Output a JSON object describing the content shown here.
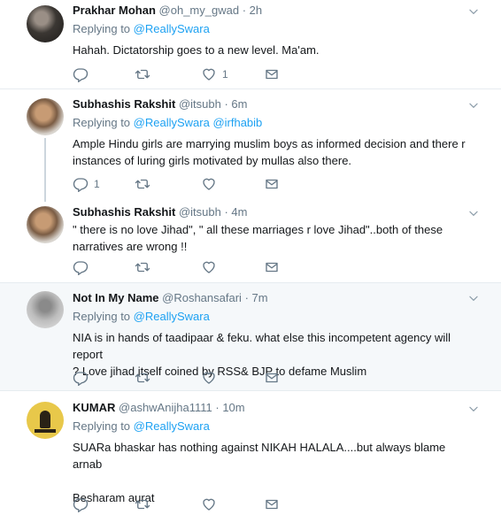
{
  "tweets": [
    {
      "name": "Prakhar Mohan",
      "handle": "@oh_my_gwad",
      "dot": "·",
      "time": "2h",
      "replying_prefix": "Replying to ",
      "replying_links": "@ReallySwara",
      "text_lines": [
        "Hahah.   Dictatorship goes to a new level. Ma'am."
      ],
      "reply_count": "",
      "like_count": "1"
    },
    {
      "name": "Subhashis Rakshit",
      "handle": "@itsubh",
      "dot": "·",
      "time": "6m",
      "replying_prefix": "Replying to ",
      "replying_links": "@ReallySwara @irfhabib",
      "text_lines": [
        "Ample Hindu girls are marrying muslim boys as informed decision and there r",
        "instances of luring girls motivated by mullas also there."
      ],
      "reply_count": "1",
      "like_count": ""
    },
    {
      "name": "Subhashis Rakshit",
      "handle": "@itsubh",
      "dot": "·",
      "time": "4m",
      "text_lines": [
        "\" there is no love Jihad\", \" all these marriages r love Jihad\"..both of these",
        "narratives are wrong !!"
      ],
      "reply_count": "",
      "like_count": ""
    },
    {
      "name": "Not In My Name",
      "handle": "@Roshansafari",
      "dot": "·",
      "time": "7m",
      "replying_prefix": "Replying to ",
      "replying_links": "@ReallySwara",
      "text_lines": [
        "NIA is in hands of taadipaar & feku. what else this incompetent agency will report",
        "? Love jihad itself coined by RSS& BJP to defame Muslim"
      ],
      "reply_count": "",
      "like_count": ""
    },
    {
      "name": "KUMAR",
      "handle": "@ashwAnijha1111",
      "dot": "·",
      "time": "10m",
      "replying_prefix": "Replying to ",
      "replying_links": "@ReallySwara",
      "text_lines": [
        "SUARa bhaskar has nothing against NIKAH HALALA....but always blame arnab",
        "",
        "Besharam aurat"
      ],
      "reply_count": "",
      "like_count": ""
    }
  ],
  "icons": {
    "reply": "reply-icon",
    "retweet": "retweet-icon",
    "like": "heart-icon",
    "message": "direct-message-icon",
    "more": "chevron-down-icon"
  },
  "colors": {
    "link": "#1da1f2",
    "secondary": "#657786",
    "highlight_bg": "#f5f8fa",
    "border": "#e6ecf0"
  }
}
